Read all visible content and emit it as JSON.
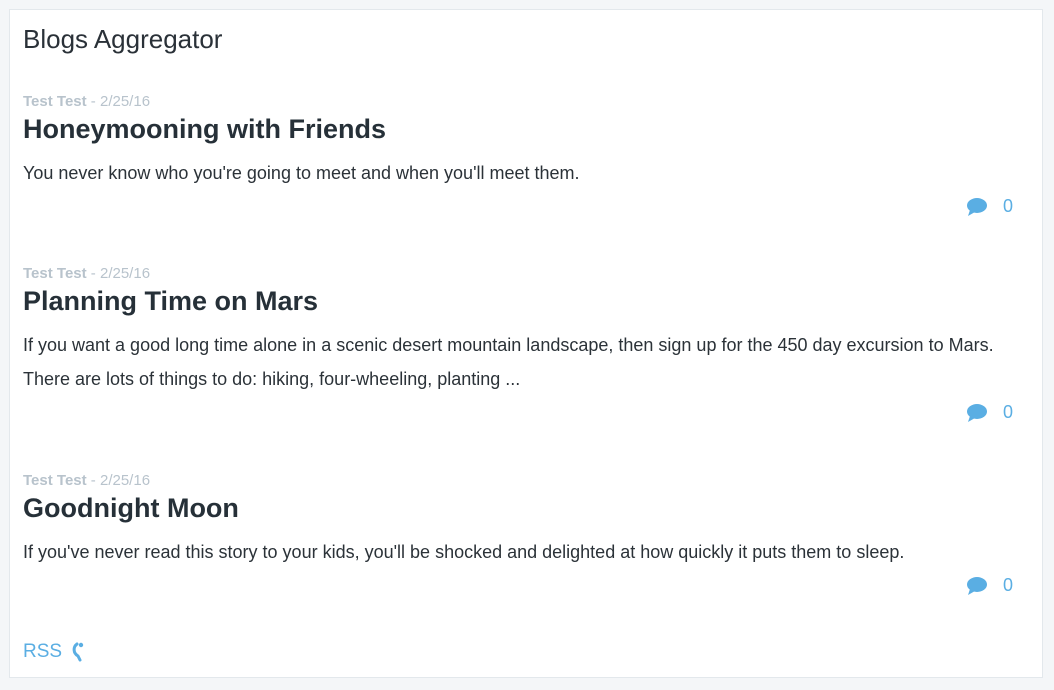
{
  "page": {
    "title": "Blogs Aggregator"
  },
  "posts": [
    {
      "author": "Test Test",
      "separator": " - ",
      "date": "2/25/16",
      "title": "Honeymooning with Friends",
      "excerpt": "You never know who you're going to meet and when you'll meet them.",
      "comment_count": "0"
    },
    {
      "author": "Test Test",
      "separator": " - ",
      "date": "2/25/16",
      "title": "Planning Time on Mars",
      "excerpt": "If you want a good long time alone in a scenic desert mountain landscape, then sign up for the 450 day excursion to Mars. There are lots of things to do: hiking, four-wheeling, planting ...",
      "comment_count": "0"
    },
    {
      "author": "Test Test",
      "separator": " - ",
      "date": "2/25/16",
      "title": "Goodnight Moon",
      "excerpt": "If you've never read this story to your kids, you'll be shocked and delighted at how quickly it puts them to sleep.",
      "comment_count": "0"
    }
  ],
  "footer": {
    "rss_label": "RSS",
    "rss_icon": "rss-feed-icon"
  },
  "icons": {
    "comment": "comment-bubble-icon"
  },
  "colors": {
    "link": "#5aaee3",
    "meta": "#b8c3cc",
    "title": "#263038"
  }
}
